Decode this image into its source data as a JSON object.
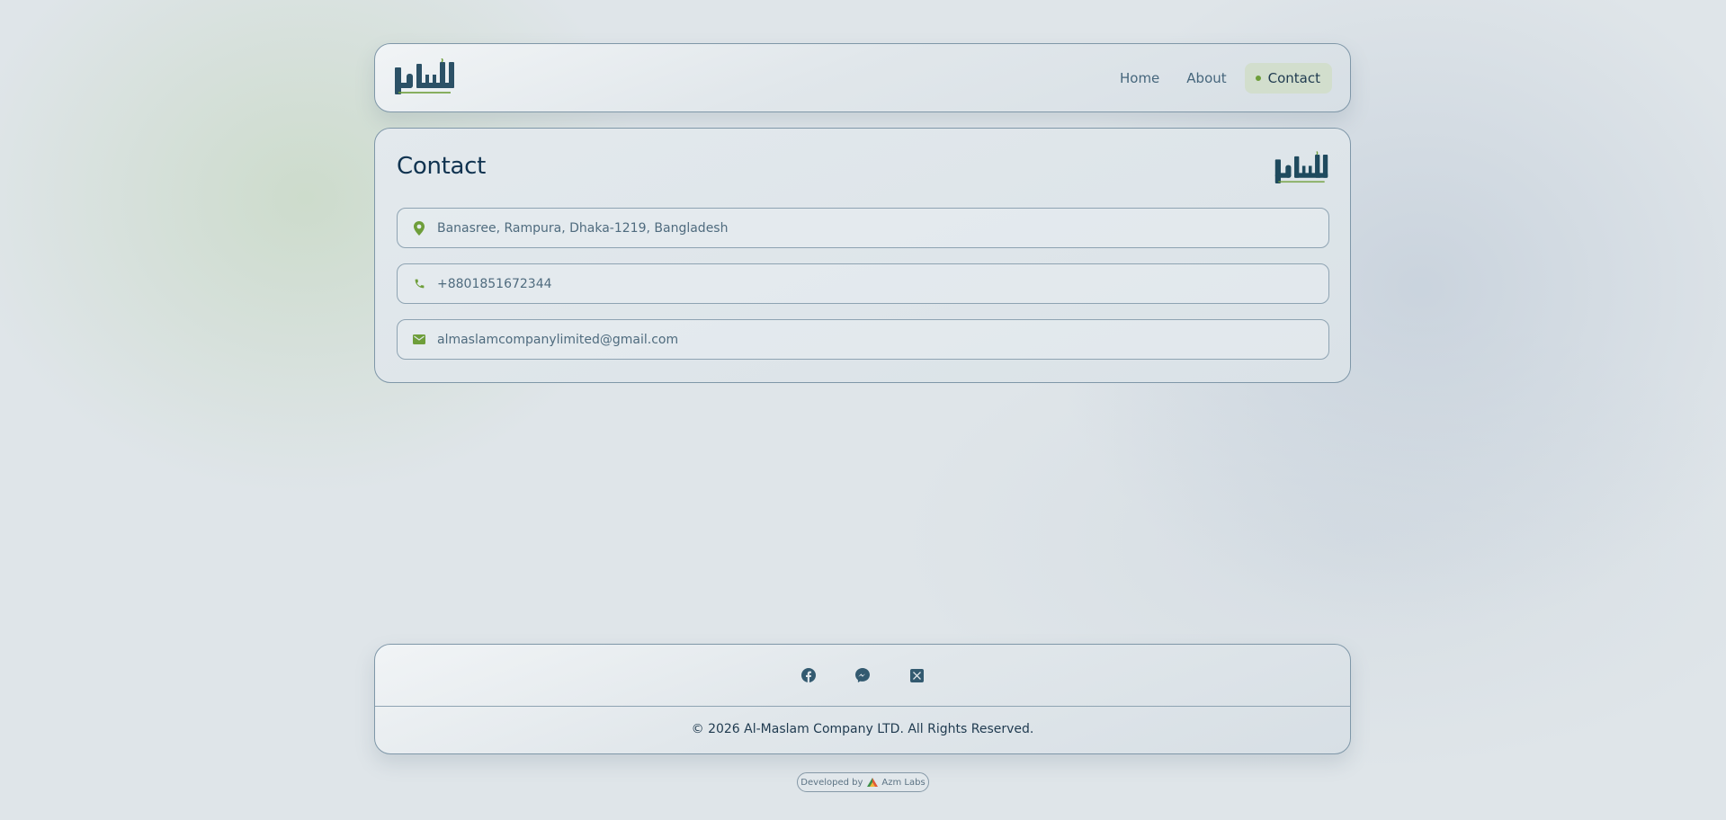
{
  "nav": {
    "items": [
      {
        "label": "Home"
      },
      {
        "label": "About"
      },
      {
        "label": "Contact",
        "active": true
      }
    ]
  },
  "contact": {
    "title": "Contact",
    "fields": [
      {
        "icon": "location-pin-icon",
        "value": "Banasree, Rampura, Dhaka-1219, Bangladesh"
      },
      {
        "icon": "phone-icon",
        "value": "+8801851672344"
      },
      {
        "icon": "mail-icon",
        "value": "almaslamcompanylimited@gmail.com"
      }
    ]
  },
  "footer": {
    "social": [
      "facebook-icon",
      "messenger-icon",
      "x-twitter-icon"
    ],
    "copyright": "© 2026 Al-Maslam Company LTD. All Rights Reserved."
  },
  "developer": {
    "prefix": "Developed by",
    "name": "Azm Labs"
  },
  "colors": {
    "accent_green": "#6e9e3a",
    "brand_dark": "#264d63",
    "text_dark": "#103350"
  }
}
